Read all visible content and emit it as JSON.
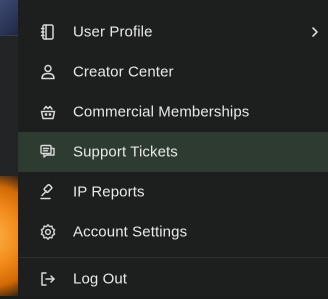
{
  "menu": {
    "items": [
      {
        "label": "User Profile",
        "icon": "notebook-icon"
      },
      {
        "label": "Creator Center",
        "icon": "user-icon"
      },
      {
        "label": "Commercial Memberships",
        "icon": "crown-basket-icon"
      },
      {
        "label": "Support Tickets",
        "icon": "chat-bubbles-icon"
      },
      {
        "label": "IP Reports",
        "icon": "gavel-icon"
      },
      {
        "label": "Account Settings",
        "icon": "gear-icon"
      },
      {
        "label": "Log Out",
        "icon": "logout-icon"
      }
    ],
    "active_index": 3
  },
  "colors": {
    "menu_bg": "#1d1e1e",
    "active_bg": "#2d3b31",
    "text": "#e9e9e9",
    "icon": "#d8d8d8"
  }
}
